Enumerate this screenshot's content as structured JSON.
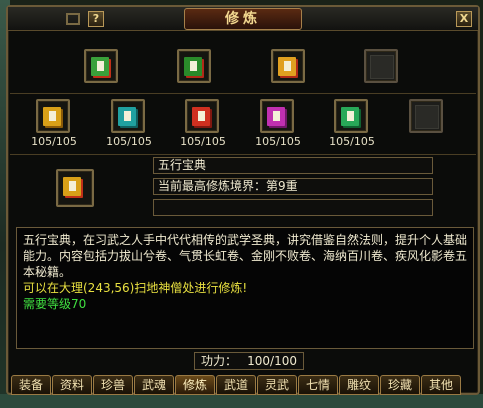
{
  "window": {
    "title": "修炼",
    "help_label": "?",
    "close_label": "X"
  },
  "top_slots": [
    {
      "icon": "red-green-skill-book-icon",
      "colors": [
        "#3aa03a",
        "#c03018"
      ]
    },
    {
      "icon": "green-red-skill-book-icon",
      "colors": [
        "#2a8a2a",
        "#b02a18"
      ]
    },
    {
      "icon": "gold-red-skill-book-icon",
      "colors": [
        "#e0a020",
        "#b02a18"
      ]
    },
    {
      "icon": "empty-slot-icon",
      "colors": []
    }
  ],
  "book_slots": [
    {
      "icon": "yellow-book-icon",
      "color": "#d8a018",
      "color2": "#8a5a08",
      "count": "105/105"
    },
    {
      "icon": "teal-book-icon",
      "color": "#20a0a0",
      "color2": "#106060",
      "count": "105/105"
    },
    {
      "icon": "red-book-icon",
      "color": "#d03020",
      "color2": "#801810",
      "count": "105/105"
    },
    {
      "icon": "magenta-book-icon",
      "color": "#c030b0",
      "color2": "#701868",
      "count": "105/105"
    },
    {
      "icon": "green-book-icon",
      "color": "#28a858",
      "color2": "#106030",
      "count": "105/105"
    },
    {
      "icon": "empty-slot-icon",
      "color": "",
      "color2": "",
      "count": ""
    }
  ],
  "selected": {
    "icon": "wuxing-book-stack-icon",
    "name": "五行宝典",
    "realm": "当前最高修炼境界：第9重",
    "extra": ""
  },
  "description": {
    "line1": "五行宝典，在习武之人手中代代相传的武学圣典，讲究借鉴自然法则，提升个人基础能力。内容包括力拔山兮卷、气贯长虹卷、金刚不败卷、海纳百川卷、疾风化影卷五本秘籍。",
    "location": "可以在大理(243,56)扫地神僧处进行修炼!",
    "requirement": "需要等级70"
  },
  "power": {
    "label": "功力：",
    "value": "100/100"
  },
  "tabs": [
    "装备",
    "资料",
    "珍兽",
    "武魂",
    "修炼",
    "武道",
    "灵武",
    "七情",
    "雕纹",
    "珍藏",
    "其他"
  ],
  "active_tab": "修炼"
}
